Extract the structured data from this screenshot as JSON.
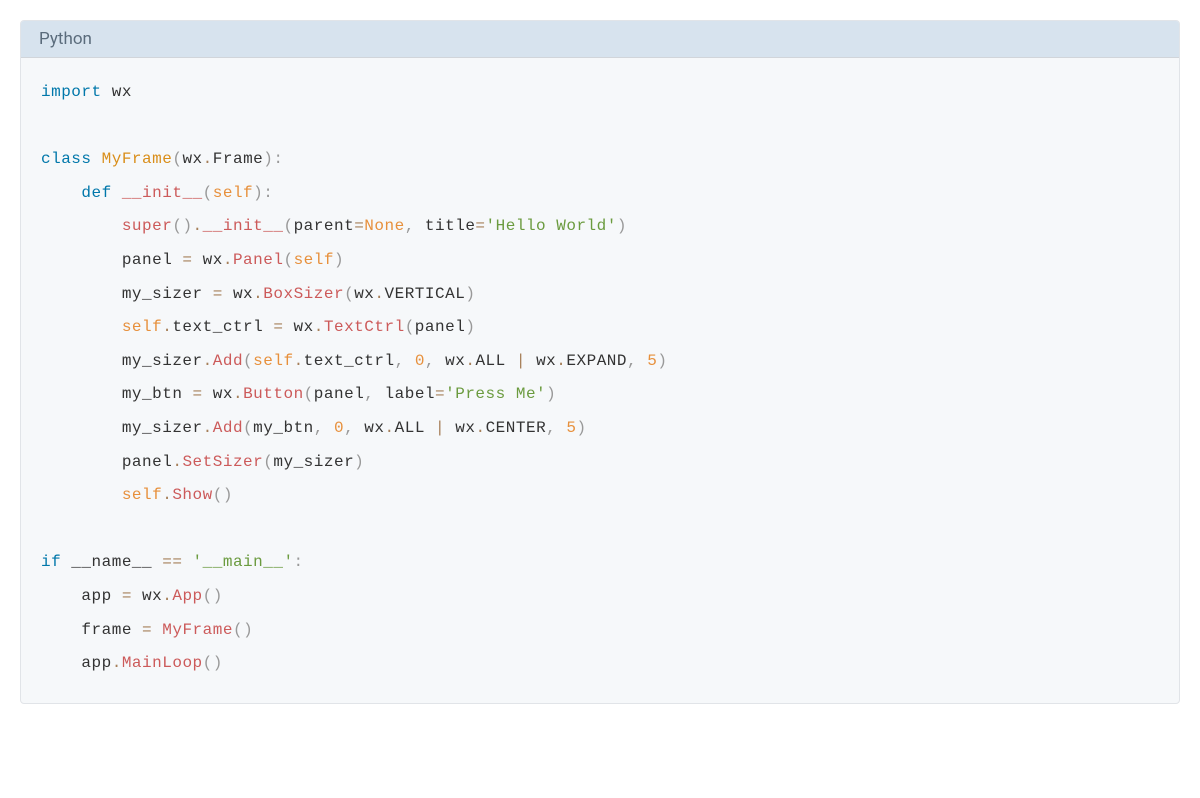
{
  "header": {
    "language": "Python"
  },
  "tokens": [
    [
      [
        "kw",
        "import"
      ],
      [
        "txt",
        " wx"
      ]
    ],
    [],
    [
      [
        "kw",
        "class"
      ],
      [
        "txt",
        " "
      ],
      [
        "cls",
        "MyFrame"
      ],
      [
        "punct",
        "("
      ],
      [
        "txt",
        "wx"
      ],
      [
        "op",
        "."
      ],
      [
        "txt",
        "Frame"
      ],
      [
        "punct",
        ")"
      ],
      [
        "punct",
        ":"
      ]
    ],
    [
      [
        "txt",
        "    "
      ],
      [
        "kw",
        "def"
      ],
      [
        "txt",
        " "
      ],
      [
        "fn",
        "__init__"
      ],
      [
        "punct",
        "("
      ],
      [
        "val",
        "self"
      ],
      [
        "punct",
        ")"
      ],
      [
        "punct",
        ":"
      ]
    ],
    [
      [
        "txt",
        "        "
      ],
      [
        "fn",
        "super"
      ],
      [
        "punct",
        "("
      ],
      [
        "punct",
        ")"
      ],
      [
        "op",
        "."
      ],
      [
        "fn",
        "__init__"
      ],
      [
        "punct",
        "("
      ],
      [
        "txt",
        "parent"
      ],
      [
        "op",
        "="
      ],
      [
        "val",
        "None"
      ],
      [
        "punct",
        ","
      ],
      [
        "txt",
        " title"
      ],
      [
        "op",
        "="
      ],
      [
        "str",
        "'Hello World'"
      ],
      [
        "punct",
        ")"
      ]
    ],
    [
      [
        "txt",
        "        panel "
      ],
      [
        "op",
        "="
      ],
      [
        "txt",
        " wx"
      ],
      [
        "op",
        "."
      ],
      [
        "fn",
        "Panel"
      ],
      [
        "punct",
        "("
      ],
      [
        "val",
        "self"
      ],
      [
        "punct",
        ")"
      ]
    ],
    [
      [
        "txt",
        "        my_sizer "
      ],
      [
        "op",
        "="
      ],
      [
        "txt",
        " wx"
      ],
      [
        "op",
        "."
      ],
      [
        "fn",
        "BoxSizer"
      ],
      [
        "punct",
        "("
      ],
      [
        "txt",
        "wx"
      ],
      [
        "op",
        "."
      ],
      [
        "txt",
        "VERTICAL"
      ],
      [
        "punct",
        ")"
      ]
    ],
    [
      [
        "txt",
        "        "
      ],
      [
        "val",
        "self"
      ],
      [
        "op",
        "."
      ],
      [
        "txt",
        "text_ctrl "
      ],
      [
        "op",
        "="
      ],
      [
        "txt",
        " wx"
      ],
      [
        "op",
        "."
      ],
      [
        "fn",
        "TextCtrl"
      ],
      [
        "punct",
        "("
      ],
      [
        "txt",
        "panel"
      ],
      [
        "punct",
        ")"
      ]
    ],
    [
      [
        "txt",
        "        my_sizer"
      ],
      [
        "op",
        "."
      ],
      [
        "fn",
        "Add"
      ],
      [
        "punct",
        "("
      ],
      [
        "val",
        "self"
      ],
      [
        "op",
        "."
      ],
      [
        "txt",
        "text_ctrl"
      ],
      [
        "punct",
        ","
      ],
      [
        "txt",
        " "
      ],
      [
        "val",
        "0"
      ],
      [
        "punct",
        ","
      ],
      [
        "txt",
        " wx"
      ],
      [
        "op",
        "."
      ],
      [
        "txt",
        "ALL "
      ],
      [
        "op",
        "|"
      ],
      [
        "txt",
        " wx"
      ],
      [
        "op",
        "."
      ],
      [
        "txt",
        "EXPAND"
      ],
      [
        "punct",
        ","
      ],
      [
        "txt",
        " "
      ],
      [
        "val",
        "5"
      ],
      [
        "punct",
        ")"
      ]
    ],
    [
      [
        "txt",
        "        my_btn "
      ],
      [
        "op",
        "="
      ],
      [
        "txt",
        " wx"
      ],
      [
        "op",
        "."
      ],
      [
        "fn",
        "Button"
      ],
      [
        "punct",
        "("
      ],
      [
        "txt",
        "panel"
      ],
      [
        "punct",
        ","
      ],
      [
        "txt",
        " label"
      ],
      [
        "op",
        "="
      ],
      [
        "str",
        "'Press Me'"
      ],
      [
        "punct",
        ")"
      ]
    ],
    [
      [
        "txt",
        "        my_sizer"
      ],
      [
        "op",
        "."
      ],
      [
        "fn",
        "Add"
      ],
      [
        "punct",
        "("
      ],
      [
        "txt",
        "my_btn"
      ],
      [
        "punct",
        ","
      ],
      [
        "txt",
        " "
      ],
      [
        "val",
        "0"
      ],
      [
        "punct",
        ","
      ],
      [
        "txt",
        " wx"
      ],
      [
        "op",
        "."
      ],
      [
        "txt",
        "ALL "
      ],
      [
        "op",
        "|"
      ],
      [
        "txt",
        " wx"
      ],
      [
        "op",
        "."
      ],
      [
        "txt",
        "CENTER"
      ],
      [
        "punct",
        ","
      ],
      [
        "txt",
        " "
      ],
      [
        "val",
        "5"
      ],
      [
        "punct",
        ")"
      ]
    ],
    [
      [
        "txt",
        "        panel"
      ],
      [
        "op",
        "."
      ],
      [
        "fn",
        "SetSizer"
      ],
      [
        "punct",
        "("
      ],
      [
        "txt",
        "my_sizer"
      ],
      [
        "punct",
        ")"
      ]
    ],
    [
      [
        "txt",
        "        "
      ],
      [
        "val",
        "self"
      ],
      [
        "op",
        "."
      ],
      [
        "fn",
        "Show"
      ],
      [
        "punct",
        "("
      ],
      [
        "punct",
        ")"
      ]
    ],
    [],
    [
      [
        "kw",
        "if"
      ],
      [
        "txt",
        " __name__ "
      ],
      [
        "op",
        "=="
      ],
      [
        "txt",
        " "
      ],
      [
        "str",
        "'__main__'"
      ],
      [
        "punct",
        ":"
      ]
    ],
    [
      [
        "txt",
        "    app "
      ],
      [
        "op",
        "="
      ],
      [
        "txt",
        " wx"
      ],
      [
        "op",
        "."
      ],
      [
        "fn",
        "App"
      ],
      [
        "punct",
        "("
      ],
      [
        "punct",
        ")"
      ]
    ],
    [
      [
        "txt",
        "    frame "
      ],
      [
        "op",
        "="
      ],
      [
        "txt",
        " "
      ],
      [
        "fn",
        "MyFrame"
      ],
      [
        "punct",
        "("
      ],
      [
        "punct",
        ")"
      ]
    ],
    [
      [
        "txt",
        "    app"
      ],
      [
        "op",
        "."
      ],
      [
        "fn",
        "MainLoop"
      ],
      [
        "punct",
        "("
      ],
      [
        "punct",
        ")"
      ]
    ]
  ]
}
